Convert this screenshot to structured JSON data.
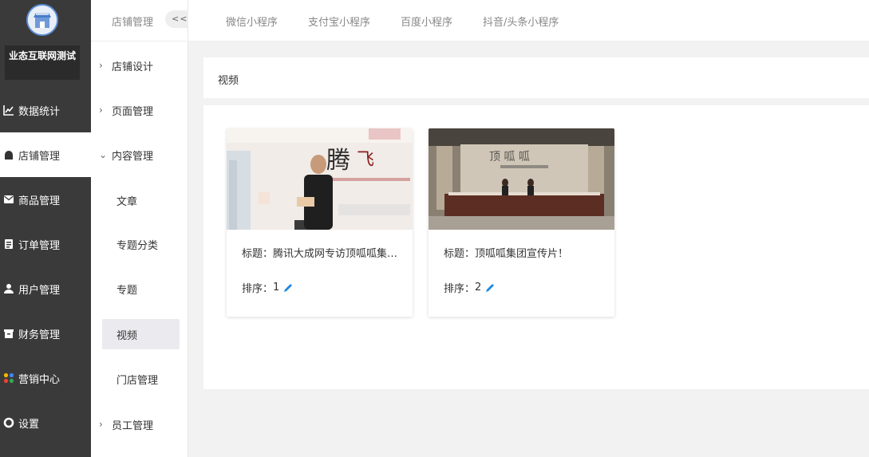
{
  "app": {
    "shop_name": "业态互联网测试",
    "accent_color": "#3a3a3a",
    "link_color": "#1e88e5"
  },
  "sidebar": {
    "items": [
      {
        "label": "数据统计",
        "icon": "chart-line-icon"
      },
      {
        "label": "店铺管理",
        "icon": "store-icon",
        "active": true
      },
      {
        "label": "商品管理",
        "icon": "envelope-icon"
      },
      {
        "label": "订单管理",
        "icon": "clipboard-icon"
      },
      {
        "label": "用户管理",
        "icon": "user-icon"
      },
      {
        "label": "财务管理",
        "icon": "finance-box-icon"
      },
      {
        "label": "营销中心",
        "icon": "marketing-icon"
      },
      {
        "label": "设置",
        "icon": "settings-dot-icon"
      }
    ]
  },
  "subnav": {
    "title": "店铺管理",
    "collapse_label": "<<",
    "items": [
      {
        "label": "店铺设计",
        "arrow": "›"
      },
      {
        "label": "页面管理",
        "arrow": "›"
      },
      {
        "label": "内容管理",
        "arrow": "⌄"
      },
      {
        "label": "文章"
      },
      {
        "label": "专题分类"
      },
      {
        "label": "专题"
      },
      {
        "label": "视频",
        "active": true
      },
      {
        "label": "门店管理"
      },
      {
        "label": "员工管理",
        "arrow": "›"
      }
    ]
  },
  "tabs": [
    "微信小程序",
    "支付宝小程序",
    "百度小程序",
    "抖音/头条小程序"
  ],
  "main": {
    "section_title": "视频",
    "videos": [
      {
        "title": "标题：腾讯大成网专访顶呱呱集团董事长",
        "sort_label": "排序：",
        "sort_value": "1"
      },
      {
        "title": "标题：顶呱呱集团宣传片！",
        "sort_label": "排序：",
        "sort_value": "2"
      }
    ]
  }
}
